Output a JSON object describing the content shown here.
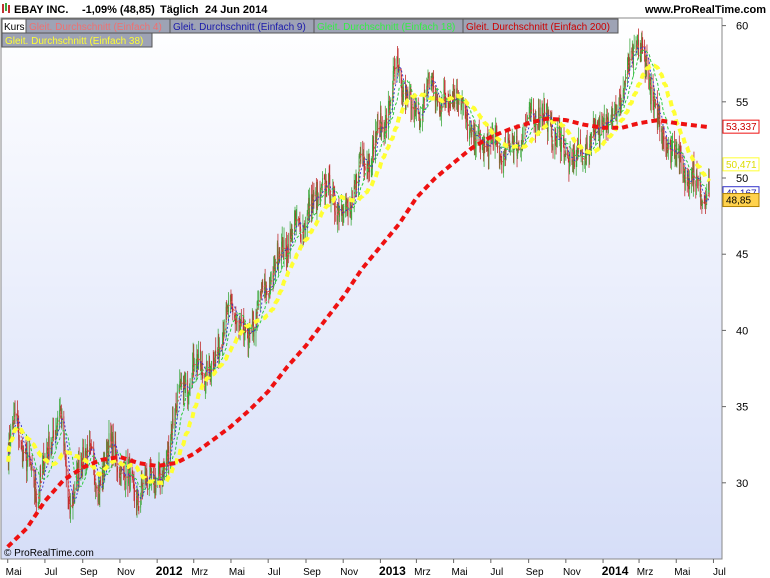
{
  "header": {
    "stock": "EBAY INC.",
    "change": "-1,09% (48,85)",
    "period": "Täglich",
    "date": "24 Jun 2014",
    "site": "www.ProRealTime.com"
  },
  "legend": {
    "kurs": "Kurs",
    "ma4": "Gleit. Durchschnitt (Einfach 4)",
    "ma9": "Gleit. Durchschnitt (Einfach 9)",
    "ma18": "Gleit. Durchschnitt (Einfach 18)",
    "ma200": "Gleit. Durchschnitt (Einfach 200)",
    "ma38": "Gleit. Durchschnitt (Einfach 38)"
  },
  "watermark": "© ProRealTime.com",
  "colors": {
    "bull": "#3fa93f",
    "bear": "#c03030",
    "ma4": "#e05050",
    "ma9": "#3333cc",
    "ma18": "#2ecc40",
    "ma38": "#ffff33",
    "ma200": "#ee1111",
    "bg_top": "#ffffff",
    "bg_bottom": "#d6def8"
  },
  "price_tags": [
    {
      "label": "53,337",
      "value": 53.337,
      "bg": "#ffffff",
      "border": "#ee1111",
      "color": "#cc0000"
    },
    {
      "label": "50,471",
      "value": 50.471,
      "bg": "#ffffff",
      "border": "#ffff33",
      "color": "#dddd00"
    },
    {
      "label": "49,167",
      "value": 49.167,
      "bg": "#ffffff",
      "border": "#3333cc",
      "color": "#2222aa"
    },
    {
      "label": "48,85",
      "value": 48.85,
      "bg": "#ffd24d",
      "border": "#b08000",
      "color": "#000000"
    }
  ],
  "chart_data": {
    "type": "candlestick",
    "title": "EBAY INC.",
    "y_ticks": [
      30,
      35,
      40,
      45,
      50,
      55,
      60
    ],
    "ylim": [
      25,
      60.5
    ],
    "x_ticks": [
      "Mai",
      "Jul",
      "Sep",
      "Nov",
      "2012",
      "Mrz",
      "Mai",
      "Jul",
      "Sep",
      "Nov",
      "2013",
      "Mrz",
      "Mai",
      "Jul",
      "Sep",
      "Nov",
      "2014",
      "Mrz",
      "Mai",
      "Jul"
    ],
    "x_tick_bold": [
      false,
      false,
      false,
      false,
      true,
      false,
      false,
      false,
      false,
      false,
      true,
      false,
      false,
      false,
      false,
      false,
      true,
      false,
      false,
      false
    ],
    "price_path": [
      [
        "2011-05-01",
        32.0
      ],
      [
        "2011-05-15",
        34.5
      ],
      [
        "2011-06-01",
        31.0
      ],
      [
        "2011-06-20",
        29.5
      ],
      [
        "2011-07-05",
        32.0
      ],
      [
        "2011-07-25",
        34.8
      ],
      [
        "2011-08-10",
        28.5
      ],
      [
        "2011-08-25",
        30.5
      ],
      [
        "2011-09-10",
        33.0
      ],
      [
        "2011-09-25",
        29.0
      ],
      [
        "2011-10-10",
        32.5
      ],
      [
        "2011-10-28",
        31.5
      ],
      [
        "2011-11-15",
        30.0
      ],
      [
        "2011-12-01",
        29.0
      ],
      [
        "2011-12-20",
        30.5
      ],
      [
        "2012-01-10",
        30.0
      ],
      [
        "2012-01-25",
        34.0
      ],
      [
        "2012-02-15",
        36.5
      ],
      [
        "2012-03-10",
        38.0
      ],
      [
        "2012-03-28",
        37.0
      ],
      [
        "2012-04-15",
        40.0
      ],
      [
        "2012-05-05",
        41.5
      ],
      [
        "2012-05-25",
        39.0
      ],
      [
        "2012-06-15",
        41.5
      ],
      [
        "2012-07-05",
        43.5
      ],
      [
        "2012-07-25",
        45.5
      ],
      [
        "2012-08-15",
        46.5
      ],
      [
        "2012-09-10",
        48.0
      ],
      [
        "2012-09-28",
        49.5
      ],
      [
        "2012-10-20",
        48.5
      ],
      [
        "2012-11-10",
        47.5
      ],
      [
        "2012-11-28",
        51.0
      ],
      [
        "2012-12-15",
        51.5
      ],
      [
        "2013-01-10",
        54.0
      ],
      [
        "2013-01-28",
        57.0
      ],
      [
        "2013-02-15",
        55.0
      ],
      [
        "2013-03-05",
        54.0
      ],
      [
        "2013-03-25",
        56.5
      ],
      [
        "2013-04-12",
        54.5
      ],
      [
        "2013-05-01",
        56.0
      ],
      [
        "2013-05-20",
        54.0
      ],
      [
        "2013-06-10",
        52.0
      ],
      [
        "2013-06-28",
        52.5
      ],
      [
        "2013-07-15",
        51.5
      ],
      [
        "2013-08-05",
        52.0
      ],
      [
        "2013-08-25",
        53.0
      ],
      [
        "2013-09-15",
        54.5
      ],
      [
        "2013-10-05",
        53.5
      ],
      [
        "2013-10-25",
        52.0
      ],
      [
        "2013-11-15",
        51.0
      ],
      [
        "2013-12-05",
        52.0
      ],
      [
        "2013-12-25",
        53.5
      ],
      [
        "2014-01-15",
        54.0
      ],
      [
        "2014-02-05",
        56.0
      ],
      [
        "2014-02-25",
        59.0
      ],
      [
        "2014-03-15",
        57.0
      ],
      [
        "2014-04-05",
        53.0
      ],
      [
        "2014-04-25",
        52.0
      ],
      [
        "2014-05-15",
        50.5
      ],
      [
        "2014-06-05",
        49.5
      ],
      [
        "2014-06-24",
        48.85
      ]
    ],
    "ma200_path": [
      [
        "2011-05-01",
        25.8
      ],
      [
        "2011-06-01",
        27.0
      ],
      [
        "2011-07-01",
        28.8
      ],
      [
        "2011-08-01",
        30.2
      ],
      [
        "2011-09-01",
        31.0
      ],
      [
        "2011-10-01",
        31.5
      ],
      [
        "2011-11-01",
        31.7
      ],
      [
        "2011-12-01",
        31.3
      ],
      [
        "2012-01-01",
        31.1
      ],
      [
        "2012-02-01",
        31.3
      ],
      [
        "2012-03-01",
        31.9
      ],
      [
        "2012-04-01",
        32.8
      ],
      [
        "2012-05-01",
        33.7
      ],
      [
        "2012-06-01",
        34.8
      ],
      [
        "2012-07-01",
        36.0
      ],
      [
        "2012-08-01",
        37.6
      ],
      [
        "2012-09-01",
        39.0
      ],
      [
        "2012-10-01",
        40.6
      ],
      [
        "2012-11-01",
        42.2
      ],
      [
        "2012-12-01",
        44.0
      ],
      [
        "2013-01-01",
        45.5
      ],
      [
        "2013-02-01",
        47.0
      ],
      [
        "2013-03-01",
        48.7
      ],
      [
        "2013-04-01",
        50.0
      ],
      [
        "2013-05-01",
        51.0
      ],
      [
        "2013-06-01",
        52.0
      ],
      [
        "2013-07-01",
        52.7
      ],
      [
        "2013-08-01",
        53.2
      ],
      [
        "2013-09-01",
        53.6
      ],
      [
        "2013-10-01",
        53.9
      ],
      [
        "2013-11-01",
        53.8
      ],
      [
        "2013-12-01",
        53.5
      ],
      [
        "2014-01-01",
        53.3
      ],
      [
        "2014-02-01",
        53.3
      ],
      [
        "2014-03-01",
        53.6
      ],
      [
        "2014-04-01",
        53.8
      ],
      [
        "2014-05-01",
        53.6
      ],
      [
        "2014-06-24",
        53.337
      ]
    ],
    "last_close": 48.85,
    "ma_last": {
      "ma200": 53.337,
      "ma38": 50.471,
      "ma9": 49.167
    },
    "grid": false
  }
}
